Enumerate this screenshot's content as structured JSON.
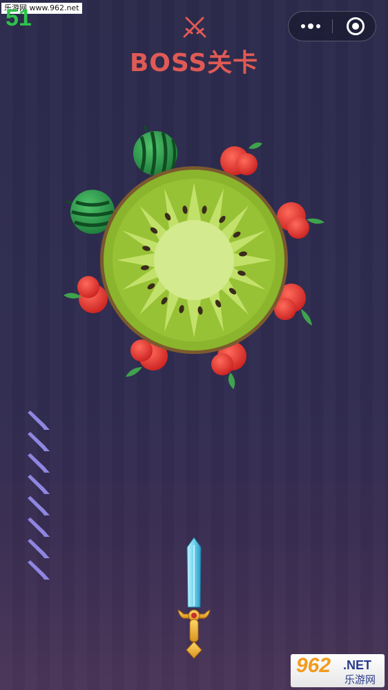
{
  "watermark_top": "乐游网 www.962.net",
  "score": "51",
  "level_title": "BOSS关卡",
  "watermark_logo": {
    "number": "962",
    "suffix": ".NET",
    "chinese": "乐游网"
  },
  "knives_remaining": 8,
  "target": {
    "kind": "kiwi",
    "stuck_fruits": [
      "watermelon",
      "watermelon",
      "apple",
      "apple",
      "apple",
      "apple",
      "apple",
      "apple",
      "apple"
    ]
  },
  "colors": {
    "score": "#2ec24b",
    "title": "#e05a55",
    "kiwi_outer": "#8bb52c",
    "kiwi_core": "#d3ea8e",
    "knife_icon": "#8e86e0"
  }
}
